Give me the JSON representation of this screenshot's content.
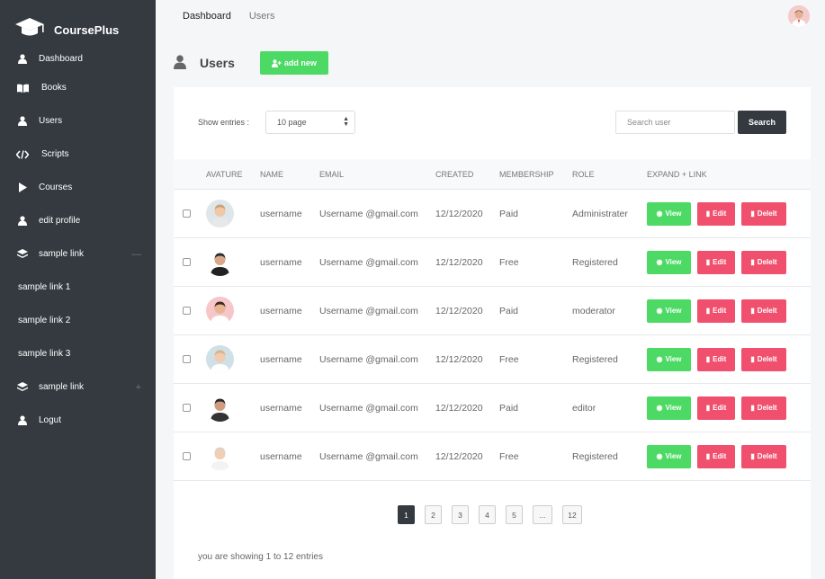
{
  "brand": {
    "name": "CoursePlus"
  },
  "sidebar": {
    "items": [
      {
        "label": "Dashboard",
        "icon": "user-icon"
      },
      {
        "label": "Books",
        "icon": "book-icon"
      },
      {
        "label": "Users",
        "icon": "user-icon"
      },
      {
        "label": "Scripts",
        "icon": "code-icon"
      },
      {
        "label": "Courses",
        "icon": "play-icon"
      },
      {
        "label": "edit profile",
        "icon": "user-icon"
      },
      {
        "label": "sample link",
        "icon": "layers-icon",
        "toggle": "—"
      },
      {
        "label": "sample link 1"
      },
      {
        "label": "sample link 2"
      },
      {
        "label": "sample link 3"
      },
      {
        "label": "sample link",
        "icon": "layers-icon",
        "toggle": "+"
      },
      {
        "label": "Logut",
        "icon": "user-icon"
      }
    ]
  },
  "topbar": {
    "links": [
      "Dashboard",
      "Users"
    ]
  },
  "page": {
    "title": "Users",
    "add_label": "add new"
  },
  "controls": {
    "show_label": "Show entries :",
    "page_size": "10 page",
    "search_placeholder": "Search user",
    "search_button": "Search"
  },
  "table": {
    "headers": [
      "AVATURE",
      "NAME",
      "EMAIL",
      "CREATED",
      "MEMBERSHIP",
      "ROLE",
      "EXPAND + LINK"
    ],
    "view_label": "View",
    "edit_label": "Edit",
    "delete_label": "Delelt",
    "rows": [
      {
        "name": "username",
        "email": "Username @gmail.com",
        "created": "12/12/2020",
        "membership": "Paid",
        "role": "Administrater"
      },
      {
        "name": "username",
        "email": "Username @gmail.com",
        "created": "12/12/2020",
        "membership": "Free",
        "role": "Registered"
      },
      {
        "name": "username",
        "email": "Username @gmail.com",
        "created": "12/12/2020",
        "membership": "Paid",
        "role": "moderator"
      },
      {
        "name": "username",
        "email": "Username @gmail.com",
        "created": "12/12/2020",
        "membership": "Free",
        "role": "Registered"
      },
      {
        "name": "username",
        "email": "Username @gmail.com",
        "created": "12/12/2020",
        "membership": "Paid",
        "role": "editor"
      },
      {
        "name": "username",
        "email": "Username @gmail.com",
        "created": "12/12/2020",
        "membership": "Free",
        "role": "Registered"
      }
    ]
  },
  "pagination": {
    "pages": [
      "1",
      "2",
      "3",
      "4",
      "5",
      "...",
      "12"
    ],
    "active": "1"
  },
  "footer": {
    "showing": "you are showing 1 to 12 entries"
  },
  "colors": {
    "sidebar": "#343a40",
    "green": "#4cd964",
    "red": "#f0506e"
  }
}
